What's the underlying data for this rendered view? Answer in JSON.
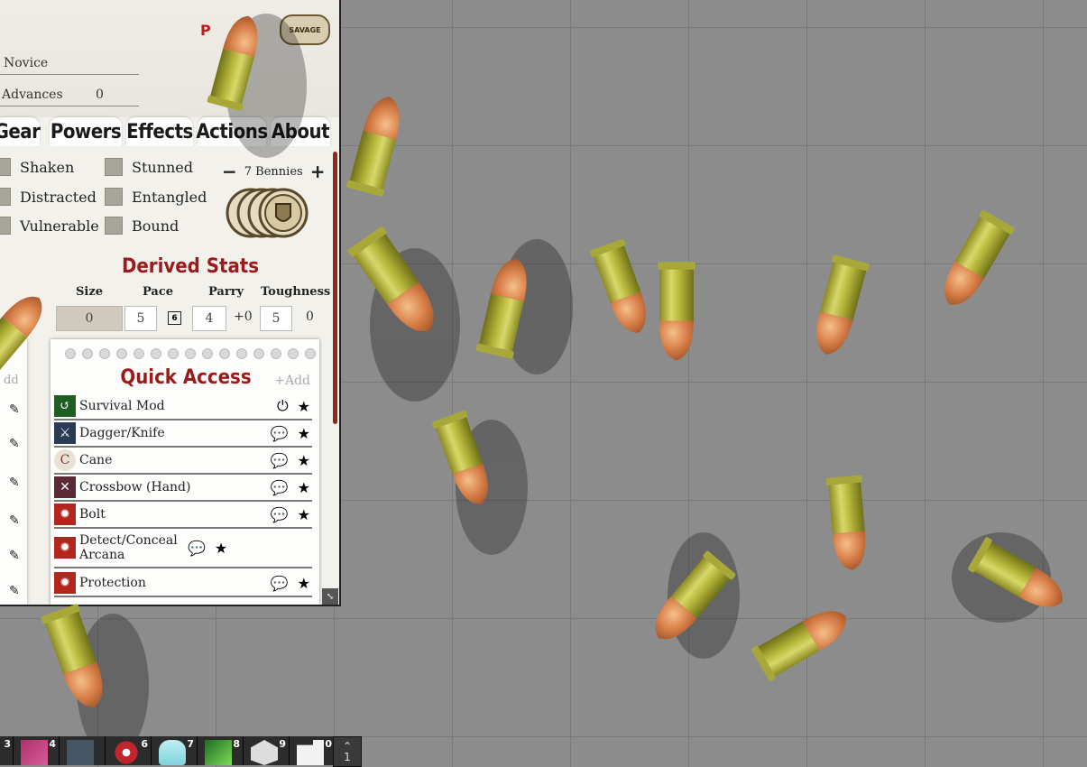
{
  "sheet": {
    "rank": "Novice",
    "advances_label": "Advances",
    "advances_value": "0",
    "logo_text": "SAVAGE",
    "tabs": [
      "Gear",
      "Powers",
      "Effects",
      "Actions",
      "About"
    ],
    "status": {
      "col1": [
        "Shaken",
        "Distracted",
        "Vulnerable"
      ],
      "col2": [
        "Stunned",
        "Entangled",
        "Bound"
      ]
    },
    "bennies": {
      "minus": "−",
      "label": "7 Bennies",
      "plus": "+"
    },
    "derived": {
      "title": "Derived Stats",
      "size_label": "Size",
      "size_value": "0",
      "pace_label": "Pace",
      "pace_value": "5",
      "pace_die": "6",
      "parry_label": "Parry",
      "parry_value": "4",
      "parry_mod": "+0",
      "toughness_label": "Toughness",
      "toughness_value": "5",
      "toughness_armor": "0"
    },
    "left_partial": "dd",
    "quick_access": {
      "title": "Quick Access",
      "add": "+Add",
      "items": [
        {
          "label": "Survival Mod",
          "icon": "survival-icon",
          "action": "power-icon"
        },
        {
          "label": "Dagger/Knife",
          "icon": "dagger-icon",
          "action": "chat-icon"
        },
        {
          "label": "Cane",
          "icon": "cane-icon",
          "action": "chat-icon"
        },
        {
          "label": "Crossbow (Hand)",
          "icon": "crossbow-icon",
          "action": "chat-icon"
        },
        {
          "label": "Bolt",
          "icon": "bolt-icon",
          "action": "chat-icon"
        },
        {
          "label": "Detect/Conceal Arcana",
          "icon": "detect-icon",
          "action": "chat-icon"
        },
        {
          "label": "Protection",
          "icon": "protection-icon",
          "action": "chat-icon"
        }
      ]
    }
  },
  "hotbar": {
    "slots": [
      "3",
      "4",
      "",
      "6",
      "7",
      "8",
      "9",
      "0"
    ],
    "page": "1"
  },
  "colors": {
    "accent": "#9c1a1a",
    "canvas": "#8c8c8c",
    "status_box": "#a9a59a"
  }
}
